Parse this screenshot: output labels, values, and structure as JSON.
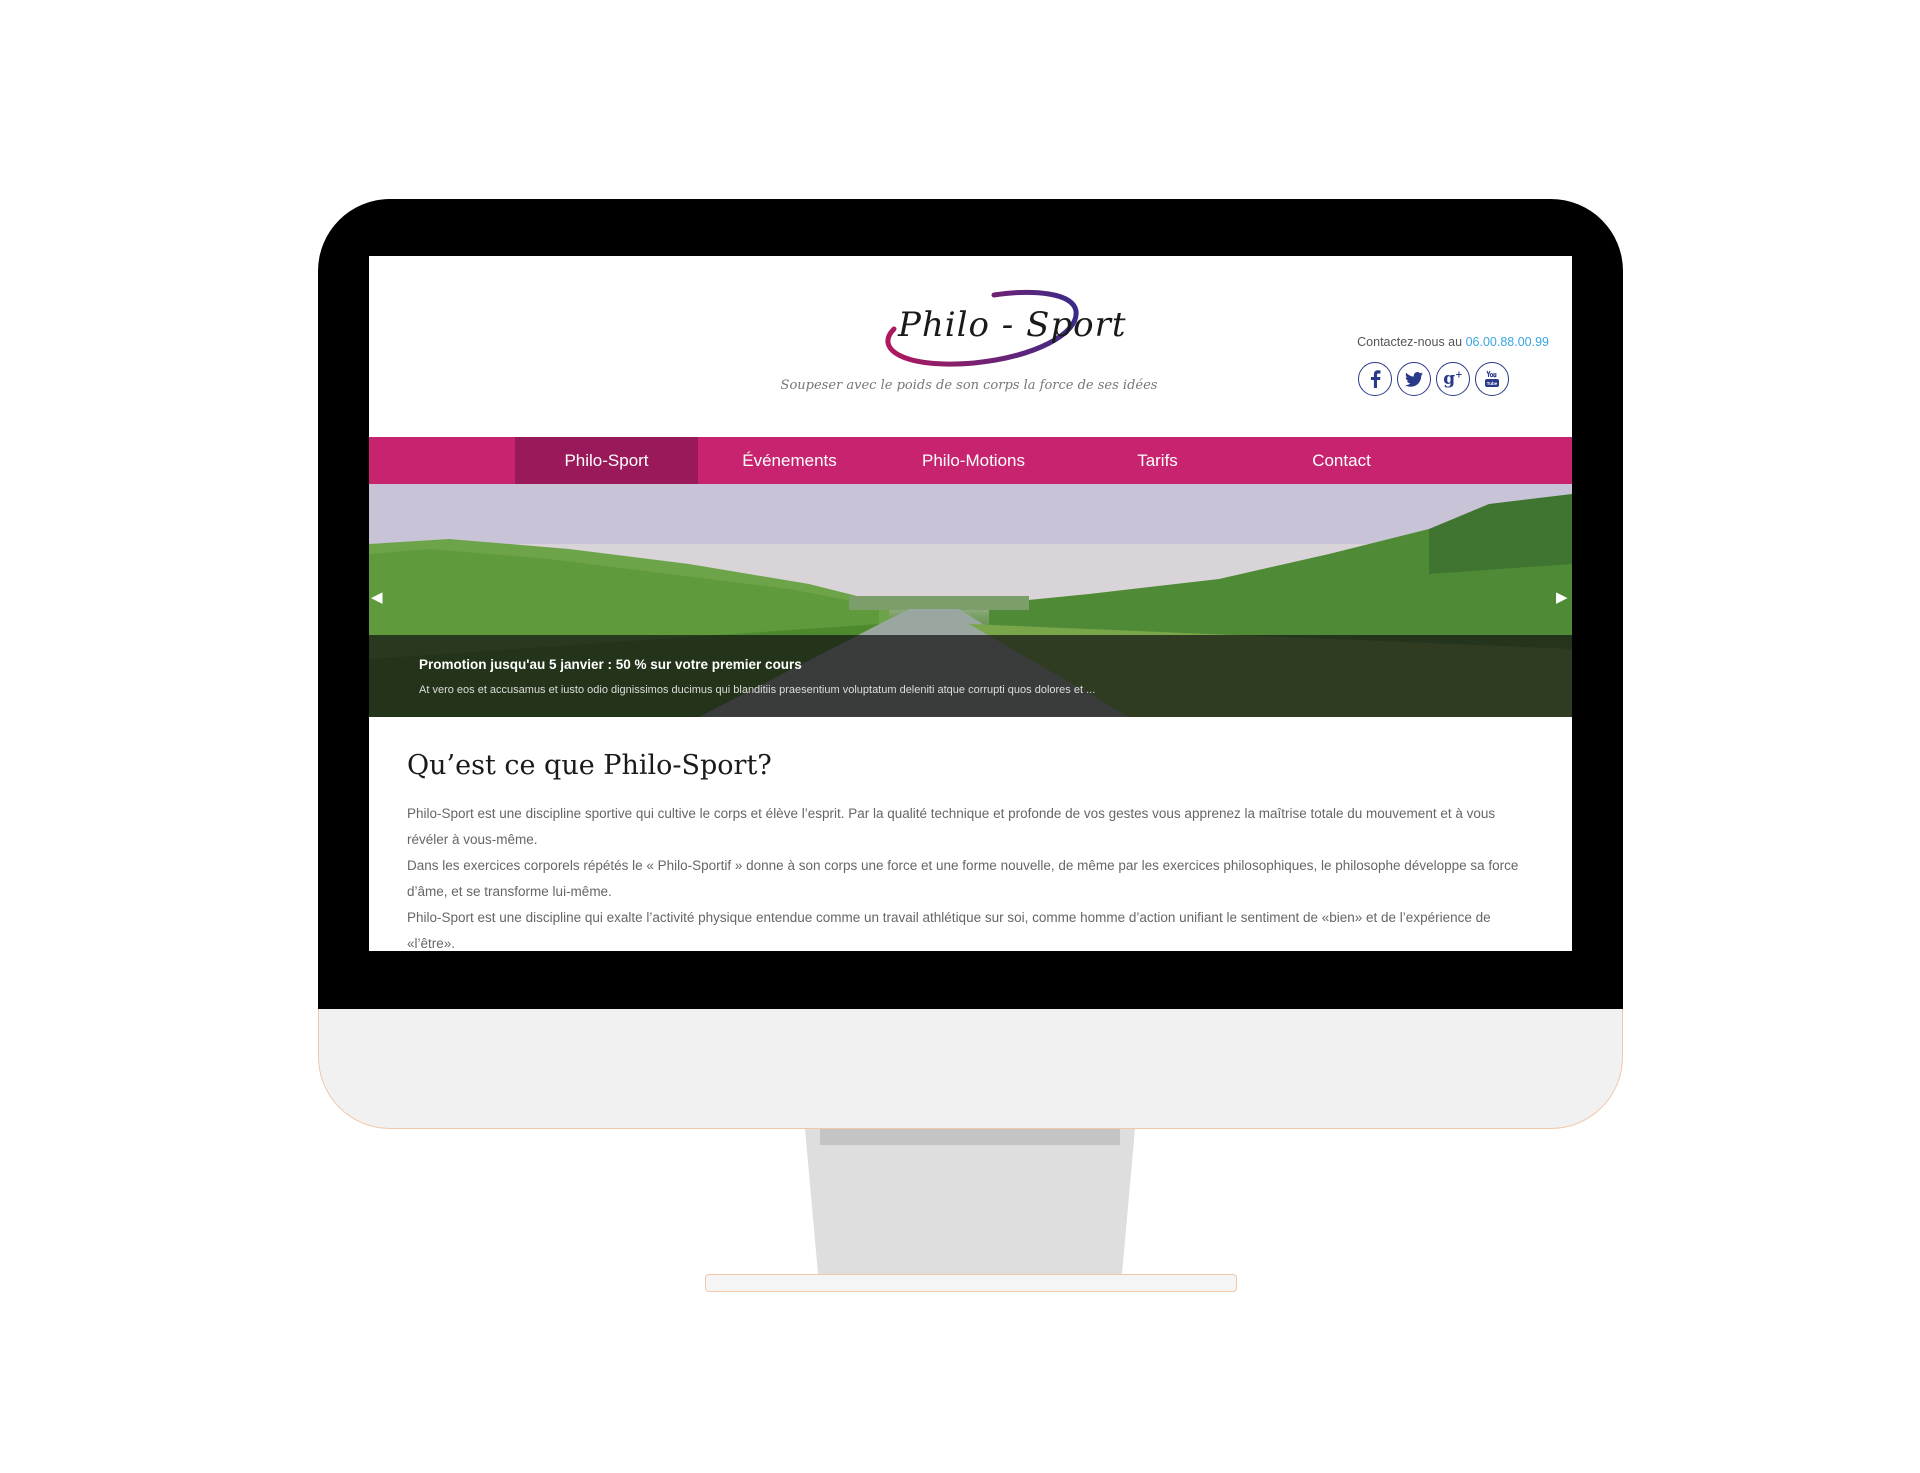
{
  "site": {
    "logo_text": "Philo - Sport",
    "tagline": "Soupeser avec le poids de son corps la force de ses idées",
    "contact_prefix": "Contactez-nous au",
    "contact_phone": "06.00.88.00.99",
    "social_icons": [
      "facebook-icon",
      "twitter-icon",
      "google-plus-icon",
      "youtube-icon"
    ]
  },
  "nav": {
    "items": [
      {
        "label": "Philo-Sport",
        "active": true
      },
      {
        "label": "Événements",
        "active": false
      },
      {
        "label": "Philo-Motions",
        "active": false
      },
      {
        "label": "Tarifs",
        "active": false
      },
      {
        "label": "Contact",
        "active": false
      }
    ]
  },
  "slider": {
    "title": "Promotion jusqu'au 5 janvier : 50 % sur votre premier cours",
    "text": "At vero eos et accusamus et iusto odio dignissimos ducimus qui blanditiis praesentium voluptatum deleniti atque corrupti quos dolores et ...",
    "prev_icon": "chevron-left-icon",
    "next_icon": "chevron-right-icon"
  },
  "content": {
    "title": "Qu’est ce que Philo-Sport?",
    "paragraphs": [
      "Philo-Sport est une discipline sportive qui cultive le corps et élève l’esprit. Par la qualité technique et profonde de vos gestes vous apprenez la maîtrise totale du mouvement et à vous révéler à vous-même.",
      "Dans les exercices corporels répétés le « Philo-Sportif » donne à son corps une force et une forme nouvelle, de même par les exercices philosophiques, le philosophe développe sa force d’âme, et se transforme lui-même.",
      "Philo-Sport est une discipline qui exalte l’activité physique entendue comme un travail athlétique sur soi, comme homme d’action unifiant le sentiment de «bien» et de l’expérience de «l’être»."
    ]
  },
  "colors": {
    "nav_bg": "#c8236f",
    "nav_active": "#99195a",
    "phone": "#3aa5e0",
    "social": "#2a3a8a"
  }
}
